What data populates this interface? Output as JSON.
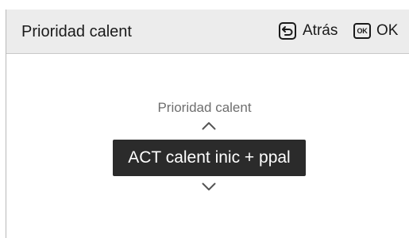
{
  "header": {
    "title": "Prioridad calent",
    "back": {
      "label": "Atrás",
      "icon": "back-return-icon"
    },
    "ok": {
      "label": "OK",
      "icon_text": "OK",
      "icon": "ok-key-icon"
    }
  },
  "setting": {
    "label": "Prioridad calent",
    "value": "ACT calent inic + ppal",
    "up_icon": "chevron-up-icon",
    "down_icon": "chevron-down-icon"
  },
  "colors": {
    "header_bg": "#ececec",
    "value_bg": "#2b2b2b",
    "value_text": "#ffffff",
    "label_text": "#6e6e6e"
  }
}
